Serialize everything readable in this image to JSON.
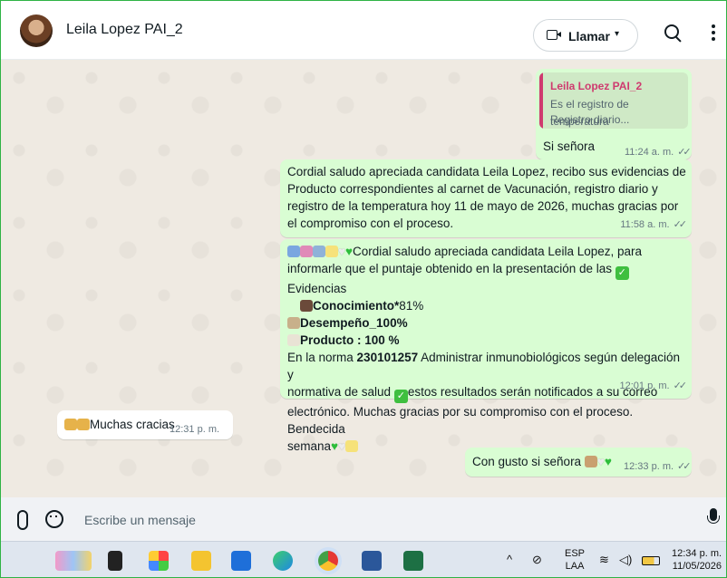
{
  "header": {
    "contact_name": "Leila Lopez PAI_2",
    "call_label": "Llamar",
    "call_caret": "▾"
  },
  "messages": {
    "m1": {
      "quote_author": "Leila Lopez PAI_2",
      "quote_line1": "Es el registro de temperatura",
      "quote_line2": "Registro diario...",
      "text": "Si señora",
      "time": "11:24 a. m."
    },
    "m2": {
      "text": "Cordial saludo apreciada candidata Leila Lopez, recibo sus evidencias de Producto correspondientes al carnet de Vacunación, registro diario y registro de la temperatura hoy 11 de mayo de 2026, muchas gracias por el compromiso con el proceso.",
      "time": "11:58 a. m."
    },
    "m3": {
      "line1": "Cordial saludo apreciada candidata Leila Lopez, para",
      "line2a": "informarle que el puntaje obtenido en la presentación de las ",
      "line2b": "Evidencias",
      "conocimiento_label": "Conocimiento*",
      "conocimiento_value": "81%",
      "desempeno_label": "Desempeño_",
      "desempeno_value": "100%",
      "producto_label": "Producto : ",
      "producto_value": "100 %",
      "norma_prefix": "En la norma ",
      "norma_code": "230101257",
      "norma_rest1": " Administrar inmunobiológicos según delegación y",
      "norma_rest2": "normativa de salud ",
      "norma_rest3": "estos resultados serán notificados a su correo",
      "line_last1": "electrónico. Muchas gracias por su compromiso con el proceso. Bendecida",
      "line_last2": "semana",
      "time": "12:01 p. m."
    },
    "m4": {
      "text": "Muchas cracias",
      "time": "12:31 p. m."
    },
    "m5": {
      "text": "Con gusto si señora",
      "time": "12:33 p. m."
    }
  },
  "composer": {
    "placeholder": "Escribe un mensaje"
  },
  "taskbar": {
    "lang_top": "ESP",
    "lang_bottom": "LAA",
    "clock_time": "12:34 p. m.",
    "clock_date": "11/05/2026"
  }
}
